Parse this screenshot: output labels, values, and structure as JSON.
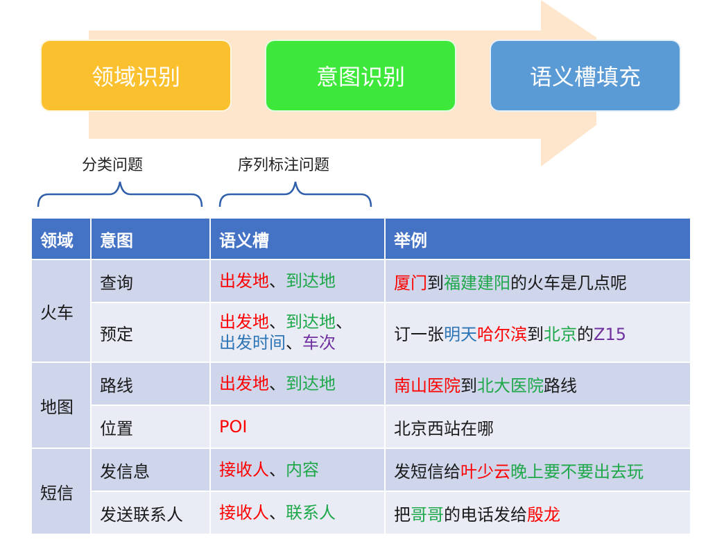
{
  "stages": [
    "领域识别",
    "意图识别",
    "语义槽填充"
  ],
  "brace_labels": [
    "分类问题",
    "序列标注问题"
  ],
  "colors": {
    "stage_domain": "#fbc02d",
    "stage_intent": "#3ee83b",
    "stage_slot": "#5b9bd5",
    "arrow": "#fde6cc",
    "header": "#4472c4",
    "row_dark": "#cfd5ea",
    "row_light": "#e9ebf5",
    "red": "#ff0000",
    "green": "#1ea84a",
    "blue": "#2e75b6",
    "purple": "#7030a0"
  },
  "table": {
    "headers": [
      "领域",
      "意图",
      "语义槽",
      "举例"
    ],
    "rows": [
      {
        "domain": "火车",
        "domain_rowspan": 2,
        "intent": "查询",
        "slots": [
          {
            "lines": [
              [
                {
                  "t": "出发地",
                  "c": "red"
                },
                {
                  "t": "、",
                  "c": "dark"
                },
                {
                  "t": "到达地",
                  "c": "green"
                }
              ]
            ]
          }
        ],
        "example": [
          [
            {
              "t": "厦门",
              "c": "red"
            },
            {
              "t": "到",
              "c": "dark"
            },
            {
              "t": "福建建阳",
              "c": "green"
            },
            {
              "t": "的火车是几点呢",
              "c": "dark"
            }
          ]
        ]
      },
      {
        "intent": "预定",
        "slots": [
          {
            "lines": [
              [
                {
                  "t": "出发地",
                  "c": "red"
                },
                {
                  "t": "、",
                  "c": "dark"
                },
                {
                  "t": "到达地",
                  "c": "green"
                },
                {
                  "t": "、",
                  "c": "dark"
                }
              ],
              [
                {
                  "t": "出发时间",
                  "c": "blue"
                },
                {
                  "t": "、",
                  "c": "dark"
                },
                {
                  "t": "车次",
                  "c": "purple"
                }
              ]
            ]
          }
        ],
        "example": [
          [
            {
              "t": "订一张",
              "c": "dark"
            },
            {
              "t": "明天",
              "c": "blue"
            },
            {
              "t": "哈尔滨",
              "c": "red"
            },
            {
              "t": "到",
              "c": "dark"
            },
            {
              "t": "北京",
              "c": "green"
            },
            {
              "t": "的",
              "c": "dark"
            },
            {
              "t": "Z15",
              "c": "purple"
            }
          ]
        ]
      },
      {
        "domain": "地图",
        "domain_rowspan": 2,
        "intent": "路线",
        "slots": [
          {
            "lines": [
              [
                {
                  "t": "出发地",
                  "c": "red"
                },
                {
                  "t": "、",
                  "c": "dark"
                },
                {
                  "t": "到达地",
                  "c": "green"
                }
              ]
            ]
          }
        ],
        "example": [
          [
            {
              "t": "南山医院",
              "c": "red"
            },
            {
              "t": "到",
              "c": "dark"
            },
            {
              "t": "北大医院",
              "c": "green"
            },
            {
              "t": "路线",
              "c": "dark"
            }
          ]
        ]
      },
      {
        "intent": "位置",
        "slots": [
          {
            "lines": [
              [
                {
                  "t": "POI",
                  "c": "red"
                }
              ]
            ]
          }
        ],
        "example": [
          [
            {
              "t": "北京西站在哪",
              "c": "dark"
            }
          ]
        ]
      },
      {
        "domain": "短信",
        "domain_rowspan": 2,
        "intent": "发信息",
        "slots": [
          {
            "lines": [
              [
                {
                  "t": "接收人",
                  "c": "red"
                },
                {
                  "t": "、",
                  "c": "dark"
                },
                {
                  "t": "内容",
                  "c": "green"
                }
              ]
            ]
          }
        ],
        "example": [
          [
            {
              "t": "发短信给",
              "c": "dark"
            },
            {
              "t": "叶少云",
              "c": "red"
            },
            {
              "t": "晚上要不要出去玩",
              "c": "green"
            }
          ]
        ]
      },
      {
        "intent": "发送联系人",
        "slots": [
          {
            "lines": [
              [
                {
                  "t": "接收人",
                  "c": "red"
                },
                {
                  "t": "、",
                  "c": "dark"
                },
                {
                  "t": "联系人",
                  "c": "green"
                }
              ]
            ]
          }
        ],
        "example": [
          [
            {
              "t": "把",
              "c": "dark"
            },
            {
              "t": "哥哥",
              "c": "green"
            },
            {
              "t": "的电话发给",
              "c": "dark"
            },
            {
              "t": "殷龙",
              "c": "red"
            }
          ]
        ]
      }
    ]
  }
}
